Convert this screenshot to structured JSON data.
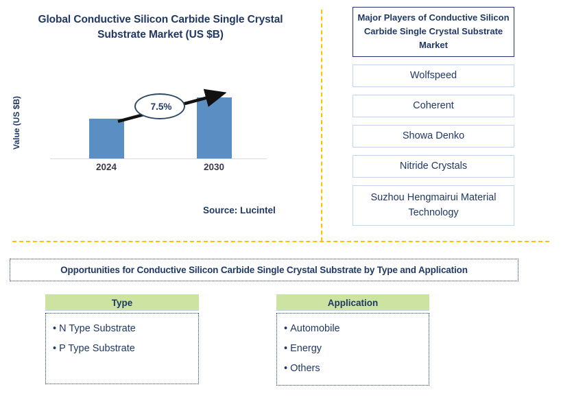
{
  "left_panel": {
    "chart_title": "Global Conductive Silicon Carbide Single Crystal Substrate Market (US $B)",
    "source": "Source: Lucintel"
  },
  "chart_data": {
    "type": "bar",
    "title": "Global Conductive Silicon Carbide Single Crystal Substrate Market (US $B)",
    "xlabel": "",
    "ylabel": "Value (US $B)",
    "categories": [
      "2024",
      "2030"
    ],
    "values": [
      58,
      89
    ],
    "grid": false,
    "legend": false,
    "annotation": {
      "label": "7.5%",
      "type": "cagr-arrow",
      "from": "2024",
      "to": "2030"
    },
    "bar_color": "#5B8FC4",
    "axis_color": "#D9D9D9"
  },
  "right_panel": {
    "header": "Major Players of Conductive Silicon Carbide Single Crystal Substrate Market",
    "players": [
      "Wolfspeed",
      "Coherent",
      "Showa Denko",
      "Nitride Crystals",
      "Suzhou Hengmairui Material Technology"
    ]
  },
  "bottom": {
    "banner": "Opportunities for Conductive Silicon Carbide Single Crystal Substrate by Type and Application",
    "segments": [
      {
        "header": "Type",
        "items": [
          "N Type Substrate",
          "P Type Substrate"
        ]
      },
      {
        "header": "Application",
        "items": [
          "Automobile",
          "Energy",
          "Others"
        ]
      }
    ]
  },
  "colors": {
    "navy": "#1F3864",
    "bar_blue": "#5B8FC4",
    "divider_gold": "#FFC000",
    "header_green": "#CCE3A2",
    "box_border_blue": "#BDD7EE"
  },
  "bullet": "•"
}
